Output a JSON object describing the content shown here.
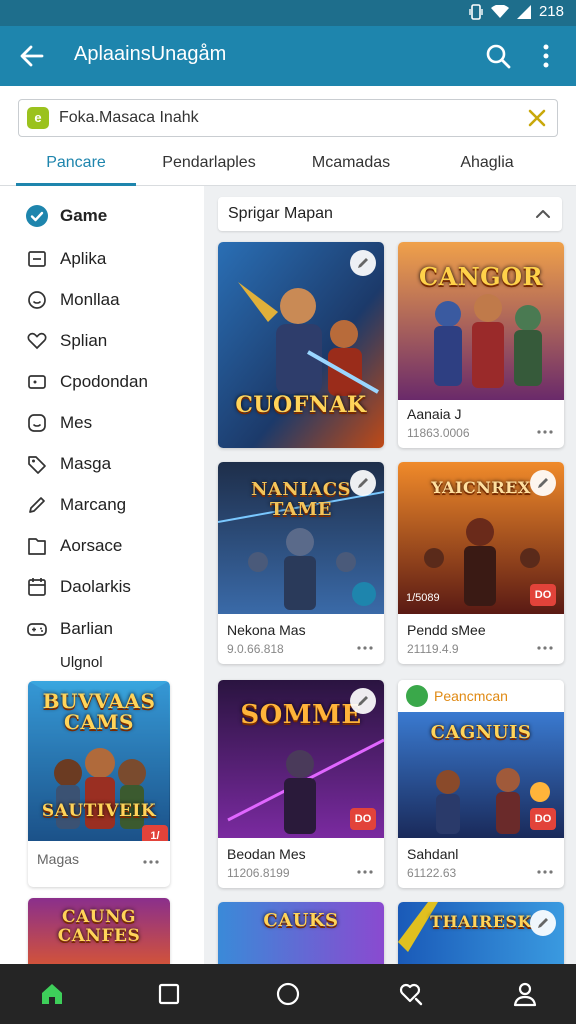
{
  "status": {
    "time": "218"
  },
  "appbar": {
    "title": "AplaainsUnagåm"
  },
  "search": {
    "value": "Foka.Masaca Inahk",
    "placeholder": ""
  },
  "tabs": [
    {
      "label": "Pancare",
      "active": true
    },
    {
      "label": "Pendarlaples",
      "active": false
    },
    {
      "label": "Mcamadas",
      "active": false
    },
    {
      "label": "Ahaglia",
      "active": false
    }
  ],
  "sidebar": {
    "items": [
      {
        "label": "Game",
        "icon": "check-circle-icon"
      },
      {
        "label": "Aplika",
        "icon": "app-window-icon"
      },
      {
        "label": "Monllaa",
        "icon": "smile-circle-icon"
      },
      {
        "label": "Splian",
        "icon": "heart-outline-icon"
      },
      {
        "label": "Cpodondan",
        "icon": "tv-icon"
      },
      {
        "label": "Mes",
        "icon": "face-icon"
      },
      {
        "label": "Masga",
        "icon": "tag-icon"
      },
      {
        "label": "Marcang",
        "icon": "pencil-icon"
      },
      {
        "label": "Aorsace",
        "icon": "folder-icon"
      },
      {
        "label": "Daolarkis",
        "icon": "calendar-icon"
      },
      {
        "label": "Barlian",
        "icon": "gamepad-icon"
      },
      {
        "label": "Ulgnol",
        "icon": "shield-icon"
      }
    ],
    "card": {
      "art_title": "BUVVAAS CAMS",
      "art_sub": "SAUTIVEIK",
      "name": "Magas",
      "badge": "1/"
    },
    "card2": {
      "art_title": "CAUNG CANFES"
    }
  },
  "section": {
    "title": "Sprigar Mapan"
  },
  "cards": [
    {
      "art_title": "CUOFNAK",
      "name": "Aanaia J",
      "size": "11863.0006",
      "badge": ""
    },
    {
      "art_title": "CANGOR",
      "name": "",
      "size": "",
      "badge": ""
    },
    {
      "art_title": "NANIACS TAME",
      "name": "Nekona Mas",
      "size": "9.0.66.818",
      "badge": ""
    },
    {
      "art_title": "YAICNREX",
      "name": "Pendd sMee",
      "size": "21119.4.9",
      "badge": "DO",
      "num": "1/5089"
    },
    {
      "art_title": "SOMME",
      "name": "Beodan Mes",
      "size": "11206.8199",
      "badge": "DO"
    },
    {
      "art_title": "CAGNUIS",
      "name": "Sahdanl",
      "size": "61122.63",
      "badge": "DO",
      "topstrip": "Peancmcan"
    },
    {
      "art_title": "CAUKS",
      "name": "",
      "size": "",
      "badge": ""
    },
    {
      "art_title": "THAIRESK",
      "name": "",
      "size": "",
      "badge": ""
    }
  ],
  "colors": {
    "accent": "#1e85ad",
    "statusbar": "#1e6e8c",
    "badge": "#e2433a",
    "nav": "#252525"
  }
}
